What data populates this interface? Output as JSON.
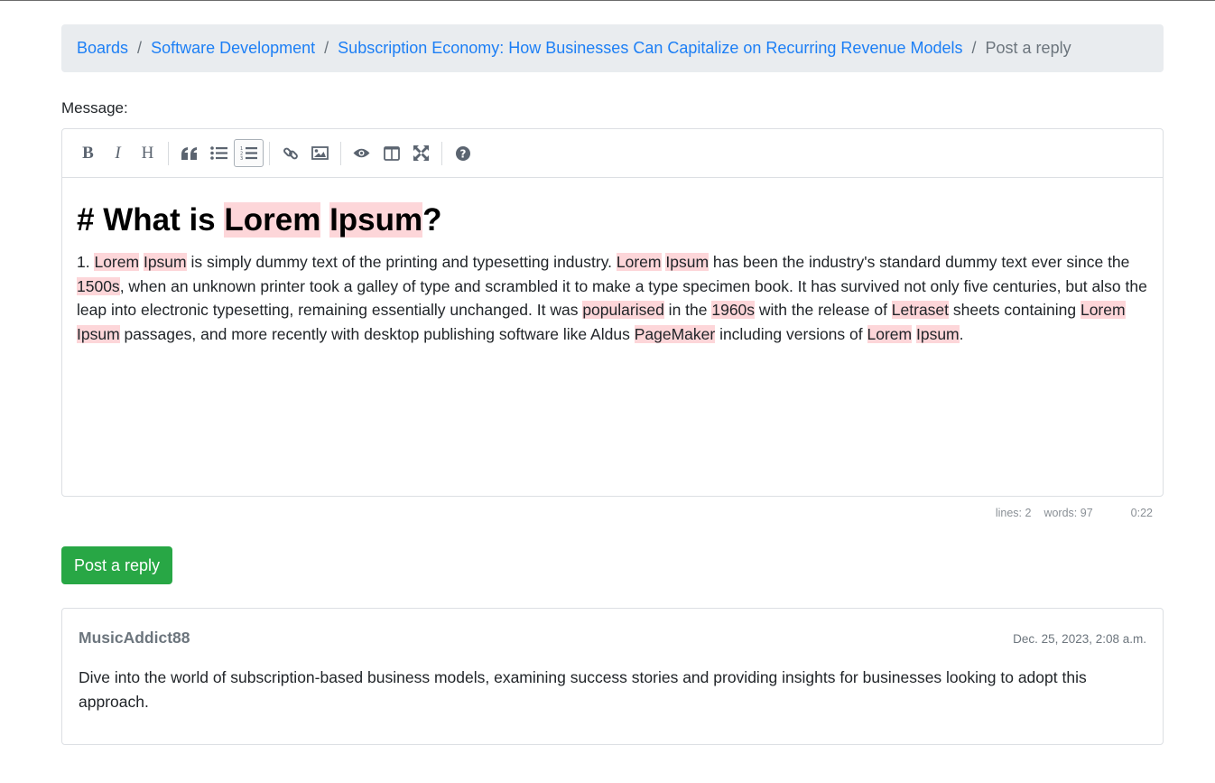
{
  "breadcrumb": {
    "items": [
      "Boards",
      "Software Development",
      "Subscription Economy: How Businesses Can Capitalize on Recurring Revenue Models"
    ],
    "current": "Post a reply",
    "separator": "/"
  },
  "form": {
    "message_label": "Message:"
  },
  "editor": {
    "toolbar": [
      {
        "name": "bold",
        "label": "B"
      },
      {
        "name": "italic",
        "label": "I"
      },
      {
        "name": "heading",
        "label": "H"
      },
      {
        "name": "quote",
        "icon": "quote-icon"
      },
      {
        "name": "unordered-list",
        "icon": "unordered-list-icon"
      },
      {
        "name": "ordered-list",
        "icon": "ordered-list-icon",
        "active": true
      },
      {
        "name": "link",
        "icon": "link-icon"
      },
      {
        "name": "image",
        "icon": "image-icon"
      },
      {
        "name": "preview",
        "icon": "eye-icon"
      },
      {
        "name": "side-by-side",
        "icon": "columns-icon"
      },
      {
        "name": "fullscreen",
        "icon": "fullscreen-icon"
      },
      {
        "name": "guide",
        "icon": "help-icon"
      }
    ],
    "heading_prefix": "# What is ",
    "heading_w1": "Lorem",
    "heading_w2": "Ipsum",
    "heading_suffix": "?",
    "paragraph_prefix": "1. ",
    "status": {
      "lines": "lines: 2",
      "words": "words: 97",
      "time": "0:22"
    },
    "highlight_color": "#fdd6d9"
  },
  "actions": {
    "post_reply": "Post a reply"
  },
  "reply": {
    "author": "MusicAddict88",
    "date": "Dec. 25, 2023, 2:08 a.m.",
    "body": "Dive into the world of subscription-based business models, examining success stories and providing insights for businesses looking to adopt this approach."
  },
  "colors": {
    "link": "#1d7ff5",
    "post_button": "#28a745",
    "breadcrumb_bg": "#e9ecef"
  }
}
